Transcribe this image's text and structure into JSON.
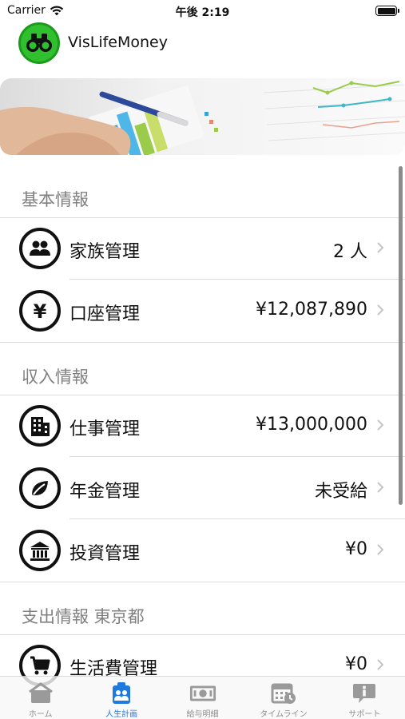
{
  "status_bar": {
    "carrier": "Carrier",
    "time": "午後 2:19"
  },
  "header": {
    "title": "VisLifeMoney"
  },
  "sections": [
    {
      "title": "基本情報",
      "rows": [
        {
          "label": "家族管理",
          "value": "2 人",
          "icon": "family-icon"
        },
        {
          "label": "口座管理",
          "value": "¥12,087,890",
          "icon": "yen-icon"
        }
      ]
    },
    {
      "title": "収入情報",
      "rows": [
        {
          "label": "仕事管理",
          "value": "¥13,000,000",
          "icon": "building-icon"
        },
        {
          "label": "年金管理",
          "value": "未受給",
          "icon": "leaf-icon"
        },
        {
          "label": "投資管理",
          "value": "¥0",
          "icon": "bank-icon"
        }
      ]
    },
    {
      "title": "支出情報 東京都",
      "rows": [
        {
          "label": "生活費管理",
          "value": "¥0",
          "icon": "cart-icon"
        }
      ]
    }
  ],
  "tabs": [
    {
      "label": "ホーム",
      "icon": "home-icon",
      "active": false
    },
    {
      "label": "人生計画",
      "icon": "life-plan-icon",
      "active": true
    },
    {
      "label": "給与明細",
      "icon": "payslip-icon",
      "active": false
    },
    {
      "label": "タイムライン",
      "icon": "timeline-icon",
      "active": false
    },
    {
      "label": "サポート",
      "icon": "support-icon",
      "active": false
    }
  ],
  "colors": {
    "accent": "#1f7ae0",
    "logo": "#2fbf2f",
    "section_header": "#808080"
  }
}
